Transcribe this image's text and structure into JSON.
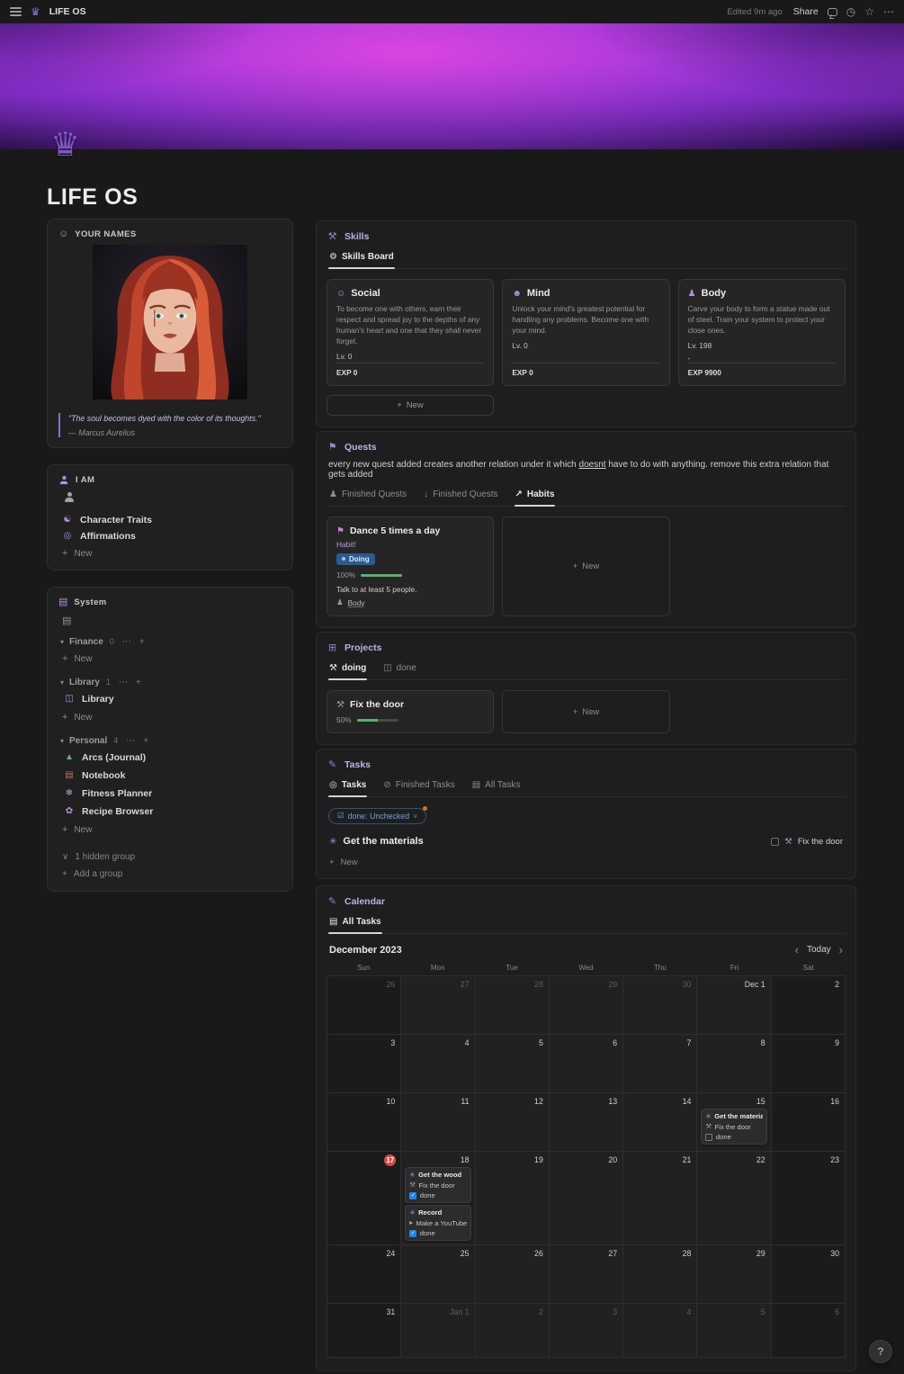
{
  "palette": {
    "accent_purple": "#b48ede",
    "status_blue": "#2b5b8f",
    "progress_green": "#5fae6e",
    "today_red": "#d44c47",
    "filter_blue": "#6ba1e8",
    "modified_orange": "#d9730d"
  },
  "icons": {
    "crown": "♛",
    "history": "◷",
    "star": "☆",
    "dots": "⋯",
    "plus": "+",
    "masks": "☺",
    "yin_yang": "☯",
    "spiral": "◎",
    "grid": "▤",
    "toggle_down": "▾",
    "chevron_down": "∨",
    "book": "◫",
    "mountains": "▲",
    "notebook": "▤",
    "snowflake": "❄",
    "flower": "✿",
    "hammer_pick": "⚒",
    "gear": "⚙",
    "smiley": "☺",
    "smiley_dark": "☻",
    "pawn": "♟",
    "flag": "⚑",
    "people": "♟",
    "arrow_down": "↓",
    "trend_up": "↗",
    "squares": "⊞",
    "box": "◫",
    "pencil": "✎",
    "target": "◎",
    "slash": "⊘",
    "checkbox": "☑",
    "caret_down": "∨",
    "pinwheel": "✳",
    "hammer": "⚒",
    "video": "▸",
    "chevron_left": "‹",
    "chevron_right": "›"
  },
  "topbar": {
    "workspace_title": "LIFE OS",
    "edited_label": "Edited 9m ago",
    "share_label": "Share"
  },
  "page": {
    "title": "LIFE OS"
  },
  "left": {
    "your_names": {
      "label": "YOUR NAMES",
      "quote": "\"The soul becomes dyed with the color of its thoughts.\"",
      "author": "— Marcus Aurelius"
    },
    "i_am": {
      "label": "I AM",
      "items": [
        "Character Traits",
        "Affirmations"
      ],
      "new_label": "New"
    },
    "system": {
      "label": "System",
      "groups": [
        {
          "name": "Finance",
          "count": "0",
          "items": []
        },
        {
          "name": "Library",
          "count": "1",
          "items": [
            "Library"
          ]
        },
        {
          "name": "Personal",
          "count": "4",
          "items": [
            "Arcs (Journal)",
            "Notebook",
            "Fitness Planner",
            "Recipe Browser"
          ]
        }
      ],
      "new_label": "New",
      "hidden_group_label": "1 hidden group",
      "add_group_label": "Add a group"
    }
  },
  "skills": {
    "label": "Skills",
    "board_tab": "Skills Board",
    "new_label": "New",
    "cards": [
      {
        "title": "Social",
        "description": "To become one with others, earn their respect and spread joy to the depths of any human's heart and one that they shall never forget.",
        "level": "Lv. 0",
        "exp": "EXP 0"
      },
      {
        "title": "Mind",
        "description": "Unlock your mind's greatest potential for handling any problems. Become one with your mind.",
        "level": "Lv. 0",
        "exp": "EXP 0"
      },
      {
        "title": "Body",
        "description": "Carve your body to form a statue made out of steel. Train your system to protect your close ones.",
        "level": "Lv. 198",
        "dash": "-",
        "exp": "EXP 9900"
      }
    ]
  },
  "quests": {
    "label": "Quests",
    "note_before": "every new quest added creates another relation under it which ",
    "note_underline": "doesnt",
    "note_after": " have to do with anything. remove this extra relation that gets added",
    "tabs": [
      "Finished Quests",
      "Finished Quests",
      "Habits"
    ],
    "card": {
      "title": "Dance 5 times a day",
      "subtitle": "Habit!",
      "status": "Doing",
      "progress": "100%",
      "progress_pct": 100,
      "description": "Talk to at least 5 people.",
      "relation": "Body"
    },
    "new_label": "New"
  },
  "projects": {
    "label": "Projects",
    "tabs": [
      "doing",
      "done"
    ],
    "card": {
      "title": "Fix the door",
      "progress": "50%",
      "progress_pct": 50
    },
    "new_label": "New"
  },
  "tasks": {
    "label": "Tasks",
    "tabs": [
      "Tasks",
      "Finished Tasks",
      "All Tasks"
    ],
    "filter_label": "done: Unchecked",
    "item_title": "Get the materials",
    "side_task": "Fix the door",
    "new_label": "New"
  },
  "calendar": {
    "label": "Calendar",
    "tab": "All Tasks",
    "month": "December 2023",
    "today_label": "Today",
    "weekdays": [
      "Sun",
      "Mon",
      "Tue",
      "Wed",
      "Thu",
      "Fri",
      "Sat"
    ],
    "weeks": [
      [
        {
          "date": "26",
          "dim": true
        },
        {
          "date": "27",
          "dim": true
        },
        {
          "date": "28",
          "dim": true
        },
        {
          "date": "29",
          "dim": true
        },
        {
          "date": "30",
          "dim": true
        },
        {
          "date": "Dec 1"
        },
        {
          "date": "2"
        }
      ],
      [
        {
          "date": "3"
        },
        {
          "date": "4"
        },
        {
          "date": "5"
        },
        {
          "date": "6"
        },
        {
          "date": "7"
        },
        {
          "date": "8"
        },
        {
          "date": "9"
        }
      ],
      [
        {
          "date": "10"
        },
        {
          "date": "11"
        },
        {
          "date": "12"
        },
        {
          "date": "13"
        },
        {
          "date": "14"
        },
        {
          "date": "15",
          "events": [
            {
              "lines": [
                {
                  "icon": "pinwheel",
                  "text": "Get the materials",
                  "bold": true
                },
                {
                  "icon": "hammer",
                  "text": "Fix the door"
                },
                {
                  "checkbox": "unchecked",
                  "text": "done"
                }
              ]
            }
          ]
        },
        {
          "date": "16"
        }
      ],
      [
        {
          "date": "17",
          "today": true
        },
        {
          "date": "18",
          "events": [
            {
              "lines": [
                {
                  "icon": "pinwheel",
                  "text": "Get the wood",
                  "bold": true
                },
                {
                  "icon": "hammer",
                  "text": "Fix the door"
                },
                {
                  "checkbox": "checked",
                  "text": "done"
                }
              ]
            },
            {
              "lines": [
                {
                  "icon": "pinwheel",
                  "text": "Record",
                  "bold": true
                },
                {
                  "icon": "video",
                  "text": "Make a YouTube Video"
                },
                {
                  "checkbox": "checked",
                  "text": "done"
                }
              ]
            }
          ]
        },
        {
          "date": "19"
        },
        {
          "date": "20"
        },
        {
          "date": "21"
        },
        {
          "date": "22"
        },
        {
          "date": "23"
        }
      ],
      [
        {
          "date": "24"
        },
        {
          "date": "25"
        },
        {
          "date": "26"
        },
        {
          "date": "27"
        },
        {
          "date": "28"
        },
        {
          "date": "29"
        },
        {
          "date": "30"
        }
      ],
      [
        {
          "date": "31"
        },
        {
          "date": "Jan 1",
          "dim": true
        },
        {
          "date": "2",
          "dim": true
        },
        {
          "date": "3",
          "dim": true
        },
        {
          "date": "4",
          "dim": true
        },
        {
          "date": "5",
          "dim": true
        },
        {
          "date": "6",
          "dim": true
        }
      ]
    ]
  },
  "help_label": "?"
}
